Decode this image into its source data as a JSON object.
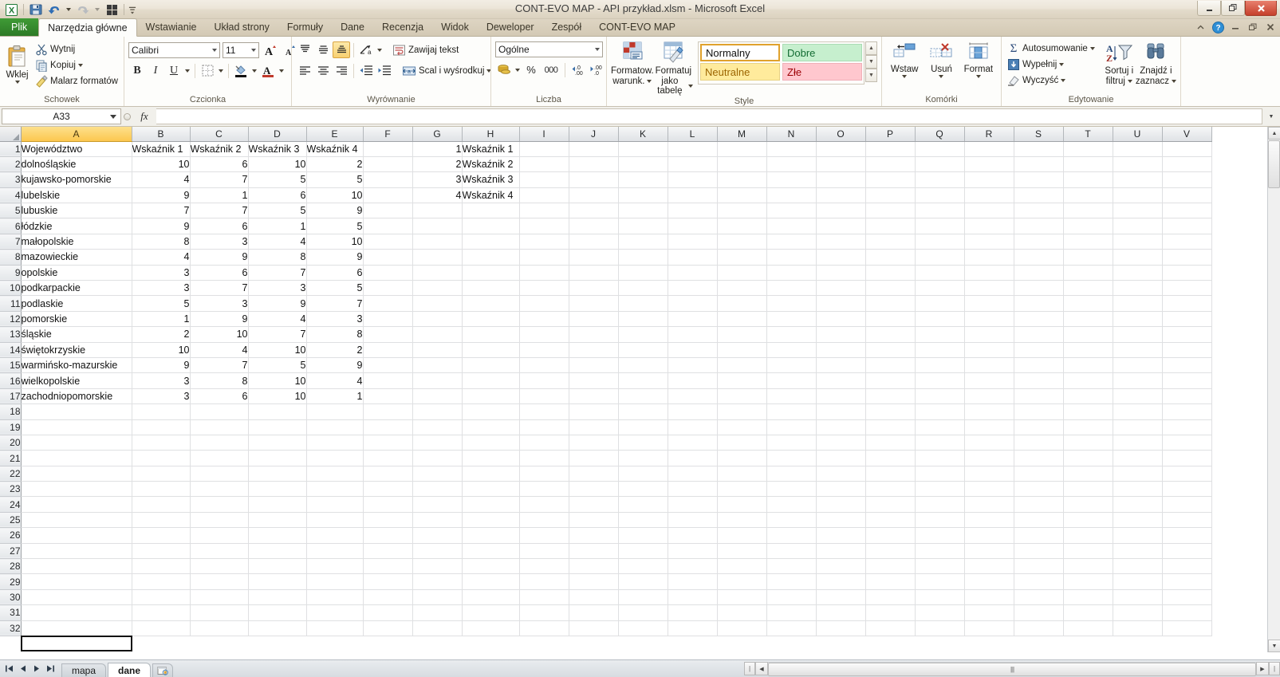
{
  "window": {
    "title": "CONT-EVO MAP - API przykład.xlsm  -  Microsoft Excel",
    "minimize": "—",
    "restore": "❐",
    "close": "✕"
  },
  "quick_access": {
    "app_icon": "excel-icon",
    "save": "save-icon",
    "undo": "undo-icon",
    "redo": "redo-icon",
    "quick_print": "quick-print-icon",
    "customize": "customize-icon"
  },
  "ribbon": {
    "help_icons": [
      "chevron-up-icon",
      "help-icon",
      "minimize-ribbon-icon",
      "restore-window-icon",
      "close-window-icon"
    ],
    "tabs": [
      {
        "label": "Plik",
        "active": false,
        "file": true
      },
      {
        "label": "Narzędzia główne",
        "active": true
      },
      {
        "label": "Wstawianie",
        "active": false
      },
      {
        "label": "Układ strony",
        "active": false
      },
      {
        "label": "Formuły",
        "active": false
      },
      {
        "label": "Dane",
        "active": false
      },
      {
        "label": "Recenzja",
        "active": false
      },
      {
        "label": "Widok",
        "active": false
      },
      {
        "label": "Deweloper",
        "active": false
      },
      {
        "label": "Zespół",
        "active": false
      },
      {
        "label": "CONT-EVO MAP",
        "active": false
      }
    ],
    "groups": {
      "clipboard": {
        "label": "Schowek",
        "paste": "Wklej",
        "cut": "Wytnij",
        "copy": "Kopiuj",
        "format_painter": "Malarz formatów"
      },
      "font": {
        "label": "Czcionka",
        "font_name": "Calibri",
        "font_size": "11",
        "grow": "A",
        "shrink": "A",
        "bold": "B",
        "italic": "I",
        "underline": "U",
        "borders": "borders-icon",
        "fill": "fill-color-icon",
        "font_color": "A"
      },
      "alignment": {
        "label": "Wyrównanie",
        "align_top": "align-top-icon",
        "align_middle": "align-middle-icon",
        "align_bottom": "align-bottom-icon",
        "orientation": "orientation-icon",
        "align_left": "align-left-icon",
        "align_center": "align-center-icon",
        "align_right": "align-right-icon",
        "decrease_indent": "decrease-indent-icon",
        "increase_indent": "increase-indent-icon",
        "wrap_text": "Zawijaj tekst",
        "merge_center": "Scal i wyśrodkuj"
      },
      "number": {
        "label": "Liczba",
        "format": "Ogólne",
        "currency": "currency-icon",
        "percent": "%",
        "comma": "000",
        "increase_decimal": "increase-decimal-icon",
        "decrease_decimal": "decrease-decimal-icon"
      },
      "styles": {
        "label": "Style",
        "conditional": "Formatow. warunk.",
        "conditional_l1": "Formatow.",
        "conditional_l2": "warunk.",
        "as_table": "Formatuj jako tabelę",
        "as_table_l1": "Formatuj",
        "as_table_l2": "jako tabelę",
        "cell_styles": [
          {
            "label": "Normalny",
            "variant": "normal"
          },
          {
            "label": "Dobre",
            "variant": "good"
          },
          {
            "label": "Neutralne",
            "variant": "neutral"
          },
          {
            "label": "Złe",
            "variant": "bad"
          }
        ]
      },
      "cells": {
        "label": "Komórki",
        "insert": "Wstaw",
        "delete": "Usuń",
        "format": "Format"
      },
      "editing": {
        "label": "Edytowanie",
        "autosum": "Autosumowanie",
        "fill": "Wypełnij",
        "clear": "Wyczyść",
        "sort_filter_l1": "Sortuj i",
        "sort_filter_l2": "filtruj",
        "find_select_l1": "Znajdź i",
        "find_select_l2": "zaznacz"
      }
    }
  },
  "formula_bar": {
    "name_box": "A33",
    "fx": "fx",
    "formula": ""
  },
  "grid": {
    "columns": [
      "A",
      "B",
      "C",
      "D",
      "E",
      "F",
      "G",
      "H",
      "I",
      "J",
      "K",
      "L",
      "M",
      "N",
      "O",
      "P",
      "Q",
      "R",
      "S",
      "T",
      "U",
      "V"
    ],
    "selected_column": "A",
    "selected_cell": "A33",
    "row_count": 32,
    "rows": [
      {
        "n": 1,
        "A": "Województwo",
        "B": "Wskaźnik 1",
        "C": "Wskaźnik 2",
        "D": "Wskaźnik 3",
        "E": "Wskaźnik 4",
        "G": "1",
        "H": "Wskaźnik 1"
      },
      {
        "n": 2,
        "A": "dolnośląskie",
        "B": "10",
        "C": "6",
        "D": "10",
        "E": "2",
        "G": "2",
        "H": "Wskaźnik 2"
      },
      {
        "n": 3,
        "A": "kujawsko-pomorskie",
        "B": "4",
        "C": "7",
        "D": "5",
        "E": "5",
        "G": "3",
        "H": "Wskaźnik 3"
      },
      {
        "n": 4,
        "A": "lubelskie",
        "B": "9",
        "C": "1",
        "D": "6",
        "E": "10",
        "G": "4",
        "H": "Wskaźnik 4"
      },
      {
        "n": 5,
        "A": "lubuskie",
        "B": "7",
        "C": "7",
        "D": "5",
        "E": "9",
        "G": "",
        "H": ""
      },
      {
        "n": 6,
        "A": "łódzkie",
        "B": "9",
        "C": "6",
        "D": "1",
        "E": "5",
        "G": "",
        "H": ""
      },
      {
        "n": 7,
        "A": "małopolskie",
        "B": "8",
        "C": "3",
        "D": "4",
        "E": "10",
        "G": "",
        "H": ""
      },
      {
        "n": 8,
        "A": "mazowieckie",
        "B": "4",
        "C": "9",
        "D": "8",
        "E": "9",
        "G": "",
        "H": ""
      },
      {
        "n": 9,
        "A": "opolskie",
        "B": "3",
        "C": "6",
        "D": "7",
        "E": "6",
        "G": "",
        "H": ""
      },
      {
        "n": 10,
        "A": "podkarpackie",
        "B": "3",
        "C": "7",
        "D": "3",
        "E": "5",
        "G": "",
        "H": ""
      },
      {
        "n": 11,
        "A": "podlaskie",
        "B": "5",
        "C": "3",
        "D": "9",
        "E": "7",
        "G": "",
        "H": ""
      },
      {
        "n": 12,
        "A": "pomorskie",
        "B": "1",
        "C": "9",
        "D": "4",
        "E": "3",
        "G": "",
        "H": ""
      },
      {
        "n": 13,
        "A": "śląskie",
        "B": "2",
        "C": "10",
        "D": "7",
        "E": "8",
        "G": "",
        "H": ""
      },
      {
        "n": 14,
        "A": "świętokrzyskie",
        "B": "10",
        "C": "4",
        "D": "10",
        "E": "2",
        "G": "",
        "H": ""
      },
      {
        "n": 15,
        "A": "warmińsko-mazurskie",
        "B": "9",
        "C": "7",
        "D": "5",
        "E": "9",
        "G": "",
        "H": ""
      },
      {
        "n": 16,
        "A": "wielkopolskie",
        "B": "3",
        "C": "8",
        "D": "10",
        "E": "4",
        "G": "",
        "H": ""
      },
      {
        "n": 17,
        "A": "zachodniopomorskie",
        "B": "3",
        "C": "6",
        "D": "10",
        "E": "1",
        "G": "",
        "H": ""
      },
      {
        "n": 18
      },
      {
        "n": 19
      },
      {
        "n": 20
      },
      {
        "n": 21
      },
      {
        "n": 22
      },
      {
        "n": 23
      },
      {
        "n": 24
      },
      {
        "n": 25
      },
      {
        "n": 26
      },
      {
        "n": 27
      },
      {
        "n": 28
      },
      {
        "n": 29
      },
      {
        "n": 30
      },
      {
        "n": 31
      },
      {
        "n": 32
      }
    ]
  },
  "sheet_tabs": {
    "first": "first-sheet-icon",
    "prev": "prev-sheet-icon",
    "next": "next-sheet-icon",
    "last": "last-sheet-icon",
    "tabs": [
      {
        "label": "mapa",
        "active": false
      },
      {
        "label": "dane",
        "active": true
      }
    ],
    "new_sheet": "new-sheet-icon"
  },
  "colors": {
    "accent_green": "#3f9b36",
    "selection_header": "#fcc74f",
    "good": "#c6efce",
    "neutral": "#ffeb9c",
    "bad": "#ffc7ce"
  }
}
